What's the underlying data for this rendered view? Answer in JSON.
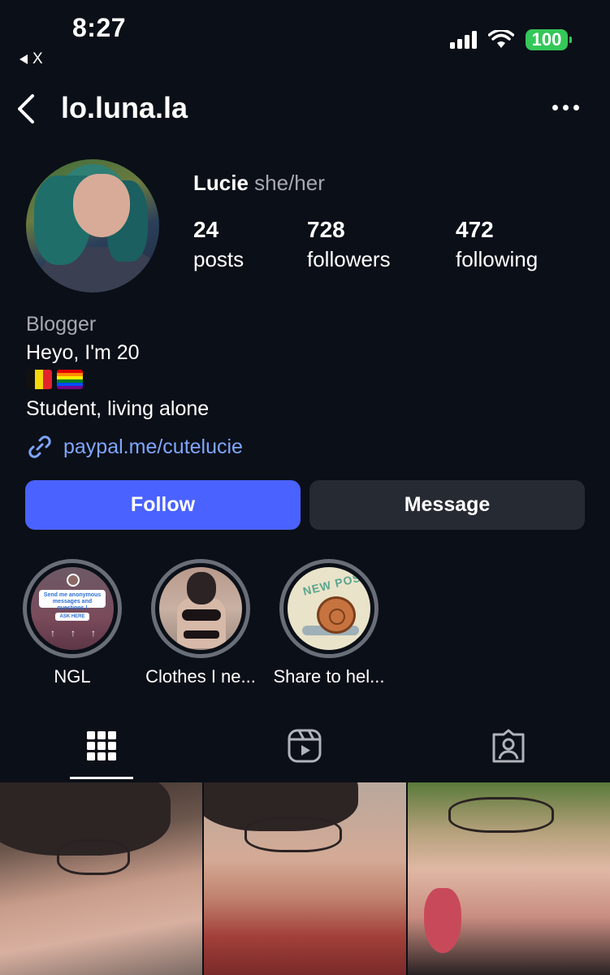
{
  "status_bar": {
    "time": "8:27",
    "back_app": "X",
    "battery": "100"
  },
  "header": {
    "username": "lo.luna.la"
  },
  "profile": {
    "name": "Lucie",
    "pronouns": "she/her",
    "stats": [
      {
        "value": "24",
        "label": "posts"
      },
      {
        "value": "728",
        "label": "followers"
      },
      {
        "value": "472",
        "label": "following"
      }
    ],
    "category": "Blogger",
    "bio": [
      "Heyo, I'm 20",
      "Student, living alone"
    ],
    "flags": [
      "belgium-flag",
      "rainbow-flag"
    ],
    "link": "paypal.me/cutelucie"
  },
  "buttons": {
    "follow": "Follow",
    "message": "Message"
  },
  "highlights": [
    {
      "label": "NGL",
      "card_text": "Send me anonymous messages and questions !",
      "ask_text": "ASK HERE"
    },
    {
      "label": "Clothes I ne..."
    },
    {
      "label": "Share to hel...",
      "badge_text": "NEW POST"
    }
  ],
  "tabs": [
    "grid-icon",
    "reels-icon",
    "tagged-icon"
  ],
  "colors": {
    "background": "#0b0f17",
    "follow_button": "#4a62ff",
    "message_button": "#262a33",
    "link": "#7fa6ff",
    "battery": "#34c759"
  }
}
